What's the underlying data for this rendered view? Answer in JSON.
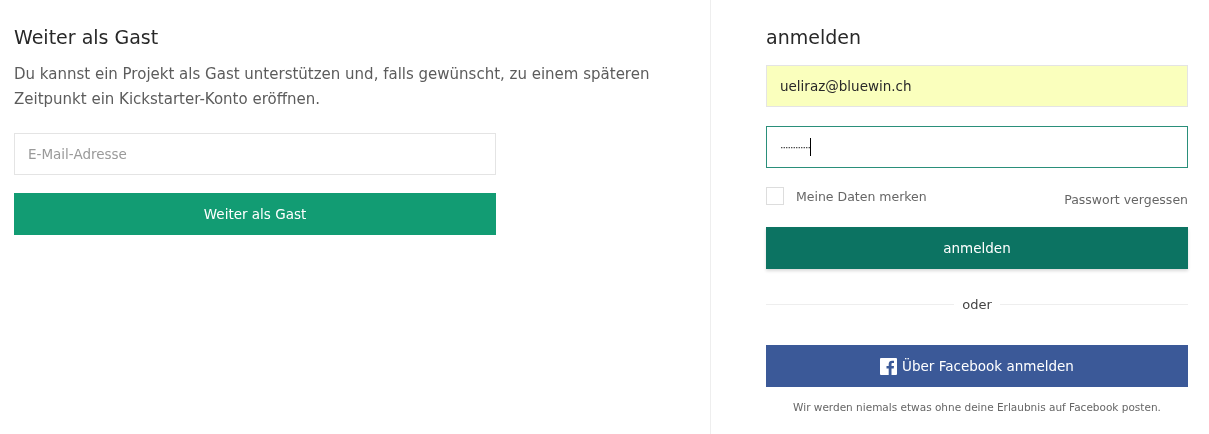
{
  "guest": {
    "title": "Weiter als Gast",
    "text": "Du kannst ein Projekt als Gast unterstützen und, falls gewünscht, zu einem späteren Zeitpunkt ein Kickstarter-Konto eröffnen.",
    "email_field": {
      "placeholder": "E-Mail-Adresse"
    },
    "button": "Weiter als Gast"
  },
  "login": {
    "title": "anmelden",
    "email_field": {
      "value": "ueliraz@bluewin.ch",
      "autofilled": true,
      "focused": false
    },
    "password_field": {
      "value": "············",
      "autofilled": false,
      "focused": true
    },
    "remember": {
      "label": "Meine Daten merken",
      "checked": false
    },
    "forgot_link": "Passwort vergessen",
    "button": "anmelden",
    "divider": "oder",
    "facebook_button": "Über Facebook anmelden",
    "facebook_note": "Wir werden niemals etwas ohne deine Erlaubnis auf Facebook posten."
  }
}
